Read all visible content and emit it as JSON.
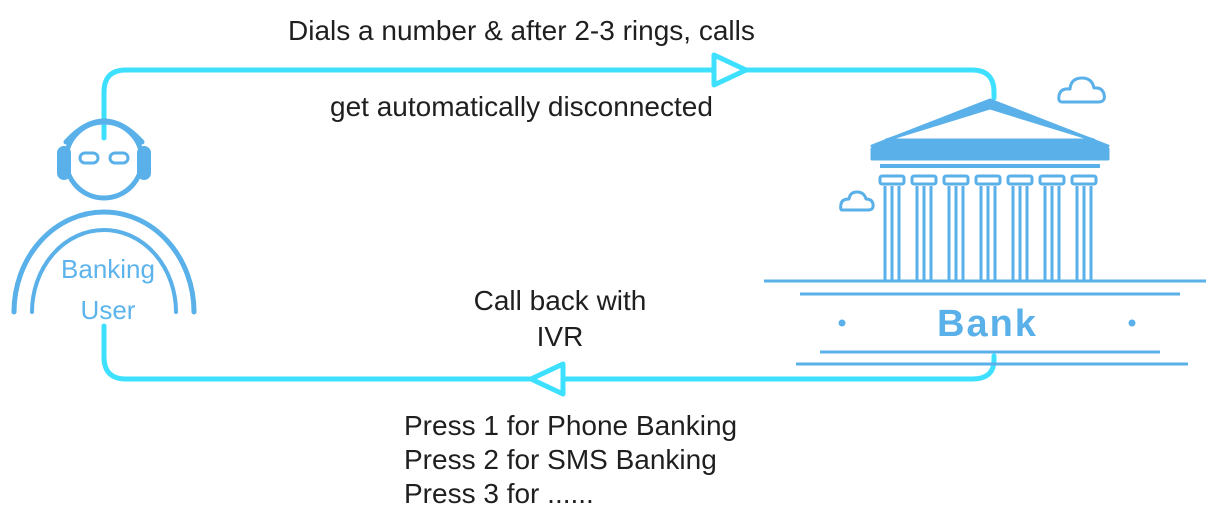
{
  "top_flow": {
    "line1": "Dials a number & after 2-3 rings, calls",
    "line2": "get automatically disconnected"
  },
  "bottom_flow": {
    "line1": "Call back with",
    "line2": "IVR"
  },
  "user": {
    "line1": "Banking",
    "line2": "User",
    "icon": "user-headset-icon"
  },
  "bank": {
    "label": "Bank",
    "icon": "bank-building-icon"
  },
  "ivr_menu": [
    "Press 1 for Phone Banking",
    "Press 2 for SMS Banking",
    "Press 3 for ......"
  ],
  "colors": {
    "flow_line": "#3ee0ff",
    "icon_blue": "#5ab0e8",
    "text": "#1f1f1f"
  }
}
